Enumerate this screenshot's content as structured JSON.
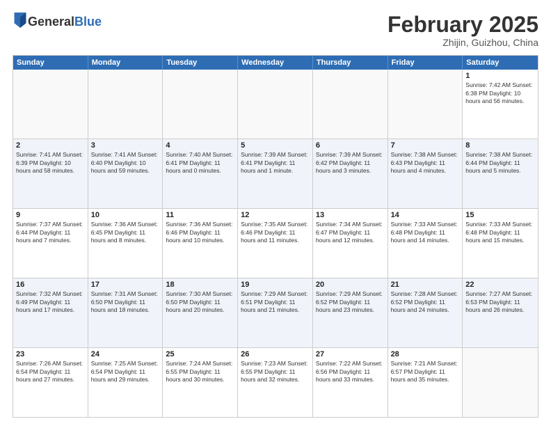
{
  "logo": {
    "general": "General",
    "blue": "Blue"
  },
  "title": {
    "month": "February 2025",
    "location": "Zhijin, Guizhou, China"
  },
  "header_days": [
    "Sunday",
    "Monday",
    "Tuesday",
    "Wednesday",
    "Thursday",
    "Friday",
    "Saturday"
  ],
  "rows": [
    {
      "alt": false,
      "cells": [
        {
          "date": "",
          "info": ""
        },
        {
          "date": "",
          "info": ""
        },
        {
          "date": "",
          "info": ""
        },
        {
          "date": "",
          "info": ""
        },
        {
          "date": "",
          "info": ""
        },
        {
          "date": "",
          "info": ""
        },
        {
          "date": "1",
          "info": "Sunrise: 7:42 AM\nSunset: 6:38 PM\nDaylight: 10 hours\nand 56 minutes."
        }
      ]
    },
    {
      "alt": true,
      "cells": [
        {
          "date": "2",
          "info": "Sunrise: 7:41 AM\nSunset: 6:39 PM\nDaylight: 10 hours\nand 58 minutes."
        },
        {
          "date": "3",
          "info": "Sunrise: 7:41 AM\nSunset: 6:40 PM\nDaylight: 10 hours\nand 59 minutes."
        },
        {
          "date": "4",
          "info": "Sunrise: 7:40 AM\nSunset: 6:41 PM\nDaylight: 11 hours\nand 0 minutes."
        },
        {
          "date": "5",
          "info": "Sunrise: 7:39 AM\nSunset: 6:41 PM\nDaylight: 11 hours\nand 1 minute."
        },
        {
          "date": "6",
          "info": "Sunrise: 7:39 AM\nSunset: 6:42 PM\nDaylight: 11 hours\nand 3 minutes."
        },
        {
          "date": "7",
          "info": "Sunrise: 7:38 AM\nSunset: 6:43 PM\nDaylight: 11 hours\nand 4 minutes."
        },
        {
          "date": "8",
          "info": "Sunrise: 7:38 AM\nSunset: 6:44 PM\nDaylight: 11 hours\nand 5 minutes."
        }
      ]
    },
    {
      "alt": false,
      "cells": [
        {
          "date": "9",
          "info": "Sunrise: 7:37 AM\nSunset: 6:44 PM\nDaylight: 11 hours\nand 7 minutes."
        },
        {
          "date": "10",
          "info": "Sunrise: 7:36 AM\nSunset: 6:45 PM\nDaylight: 11 hours\nand 8 minutes."
        },
        {
          "date": "11",
          "info": "Sunrise: 7:36 AM\nSunset: 6:46 PM\nDaylight: 11 hours\nand 10 minutes."
        },
        {
          "date": "12",
          "info": "Sunrise: 7:35 AM\nSunset: 6:46 PM\nDaylight: 11 hours\nand 11 minutes."
        },
        {
          "date": "13",
          "info": "Sunrise: 7:34 AM\nSunset: 6:47 PM\nDaylight: 11 hours\nand 12 minutes."
        },
        {
          "date": "14",
          "info": "Sunrise: 7:33 AM\nSunset: 6:48 PM\nDaylight: 11 hours\nand 14 minutes."
        },
        {
          "date": "15",
          "info": "Sunrise: 7:33 AM\nSunset: 6:48 PM\nDaylight: 11 hours\nand 15 minutes."
        }
      ]
    },
    {
      "alt": true,
      "cells": [
        {
          "date": "16",
          "info": "Sunrise: 7:32 AM\nSunset: 6:49 PM\nDaylight: 11 hours\nand 17 minutes."
        },
        {
          "date": "17",
          "info": "Sunrise: 7:31 AM\nSunset: 6:50 PM\nDaylight: 11 hours\nand 18 minutes."
        },
        {
          "date": "18",
          "info": "Sunrise: 7:30 AM\nSunset: 6:50 PM\nDaylight: 11 hours\nand 20 minutes."
        },
        {
          "date": "19",
          "info": "Sunrise: 7:29 AM\nSunset: 6:51 PM\nDaylight: 11 hours\nand 21 minutes."
        },
        {
          "date": "20",
          "info": "Sunrise: 7:29 AM\nSunset: 6:52 PM\nDaylight: 11 hours\nand 23 minutes."
        },
        {
          "date": "21",
          "info": "Sunrise: 7:28 AM\nSunset: 6:52 PM\nDaylight: 11 hours\nand 24 minutes."
        },
        {
          "date": "22",
          "info": "Sunrise: 7:27 AM\nSunset: 6:53 PM\nDaylight: 11 hours\nand 26 minutes."
        }
      ]
    },
    {
      "alt": false,
      "cells": [
        {
          "date": "23",
          "info": "Sunrise: 7:26 AM\nSunset: 6:54 PM\nDaylight: 11 hours\nand 27 minutes."
        },
        {
          "date": "24",
          "info": "Sunrise: 7:25 AM\nSunset: 6:54 PM\nDaylight: 11 hours\nand 29 minutes."
        },
        {
          "date": "25",
          "info": "Sunrise: 7:24 AM\nSunset: 6:55 PM\nDaylight: 11 hours\nand 30 minutes."
        },
        {
          "date": "26",
          "info": "Sunrise: 7:23 AM\nSunset: 6:55 PM\nDaylight: 11 hours\nand 32 minutes."
        },
        {
          "date": "27",
          "info": "Sunrise: 7:22 AM\nSunset: 6:56 PM\nDaylight: 11 hours\nand 33 minutes."
        },
        {
          "date": "28",
          "info": "Sunrise: 7:21 AM\nSunset: 6:57 PM\nDaylight: 11 hours\nand 35 minutes."
        },
        {
          "date": "",
          "info": ""
        }
      ]
    }
  ]
}
